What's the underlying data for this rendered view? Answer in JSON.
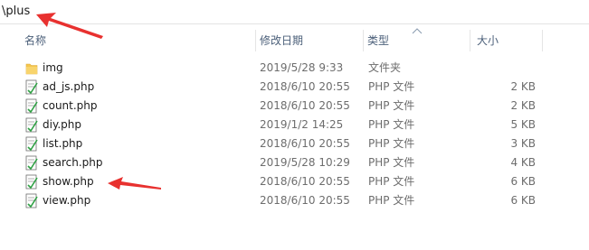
{
  "address": {
    "path": "\\plus"
  },
  "columns": {
    "name": "名称",
    "date": "修改日期",
    "type": "类型",
    "size": "大小"
  },
  "files": [
    {
      "name": "img",
      "date": "2019/5/28 9:33",
      "type": "文件夹",
      "size": "",
      "icon": "folder-icon"
    },
    {
      "name": "ad_js.php",
      "date": "2018/6/10 20:55",
      "type": "PHP 文件",
      "size": "2 KB",
      "icon": "php-file-icon"
    },
    {
      "name": "count.php",
      "date": "2018/6/10 20:55",
      "type": "PHP 文件",
      "size": "2 KB",
      "icon": "php-file-icon"
    },
    {
      "name": "diy.php",
      "date": "2019/1/2 14:25",
      "type": "PHP 文件",
      "size": "5 KB",
      "icon": "php-file-icon"
    },
    {
      "name": "list.php",
      "date": "2018/6/10 20:55",
      "type": "PHP 文件",
      "size": "3 KB",
      "icon": "php-file-icon"
    },
    {
      "name": "search.php",
      "date": "2019/5/28 10:29",
      "type": "PHP 文件",
      "size": "4 KB",
      "icon": "php-file-icon"
    },
    {
      "name": "show.php",
      "date": "2018/6/10 20:55",
      "type": "PHP 文件",
      "size": "6 KB",
      "icon": "php-file-icon"
    },
    {
      "name": "view.php",
      "date": "2018/6/10 20:55",
      "type": "PHP 文件",
      "size": "6 KB",
      "icon": "php-file-icon"
    }
  ],
  "colors": {
    "annotation_arrow": "#e8312f",
    "folder": "#f5c64e",
    "header_text": "#4c607a"
  }
}
